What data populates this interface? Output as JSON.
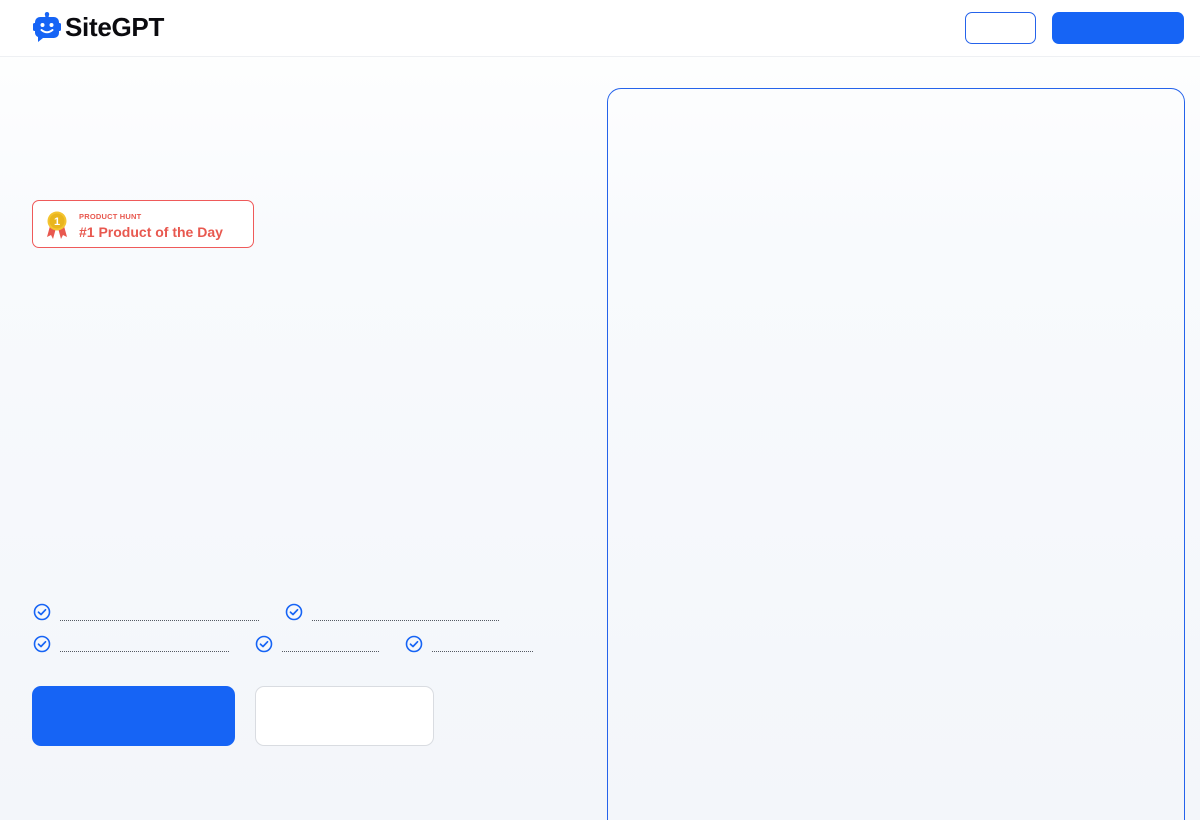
{
  "brand": {
    "name": "SiteGPT",
    "logo_icon": "robot-chat-icon",
    "accent_color": "#1664f5",
    "text_color": "#0b0b0f"
  },
  "nav": {
    "login_label": "",
    "signup_label": ""
  },
  "badge": {
    "kicker": "PRODUCT HUNT",
    "title": "#1 Product of the Day",
    "icon": "medal-icon",
    "medal_number": "1",
    "color": "#e8584f"
  },
  "features": {
    "icon": "check-circle-icon",
    "items": [
      "",
      "",
      "",
      "",
      ""
    ]
  },
  "cta": {
    "primary_label": "",
    "secondary_label": ""
  },
  "demo_panel": {
    "content": ""
  }
}
